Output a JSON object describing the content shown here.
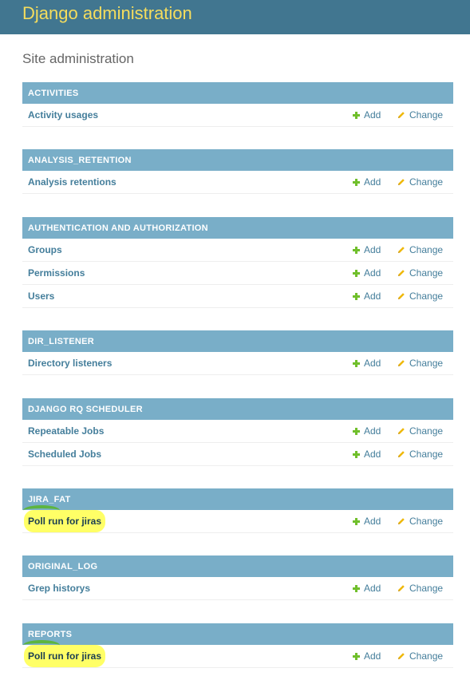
{
  "header": {
    "branding": "Django administration"
  },
  "page_title": "Site administration",
  "common": {
    "add_label": "Add",
    "change_label": "Change"
  },
  "colors": {
    "header_bg": "#417690",
    "branding": "#f5dd5d",
    "caption_bg": "#79aec8",
    "link": "#447e9b",
    "add_icon": "#70bf2b",
    "change_icon": "#efb80b",
    "highlight": "#ffff66"
  },
  "modules": [
    {
      "caption": "Activities",
      "models": [
        {
          "name": "Activity usages"
        }
      ]
    },
    {
      "caption": "Analysis_retention",
      "models": [
        {
          "name": "Analysis retentions"
        }
      ]
    },
    {
      "caption": "Authentication and Authorization",
      "models": [
        {
          "name": "Groups"
        },
        {
          "name": "Permissions"
        },
        {
          "name": "Users"
        }
      ]
    },
    {
      "caption": "Dir_listener",
      "models": [
        {
          "name": "Directory listeners"
        }
      ]
    },
    {
      "caption": "Django RQ Scheduler",
      "models": [
        {
          "name": "Repeatable Jobs"
        },
        {
          "name": "Scheduled Jobs"
        }
      ]
    },
    {
      "caption": "Jira_fat",
      "models": [
        {
          "name": "Poll run for jiras",
          "highlighted": true
        }
      ]
    },
    {
      "caption": "Original_log",
      "models": [
        {
          "name": "Grep historys"
        }
      ]
    },
    {
      "caption": "Reports",
      "models": [
        {
          "name": "Poll run for jiras",
          "highlighted": true
        }
      ]
    }
  ]
}
